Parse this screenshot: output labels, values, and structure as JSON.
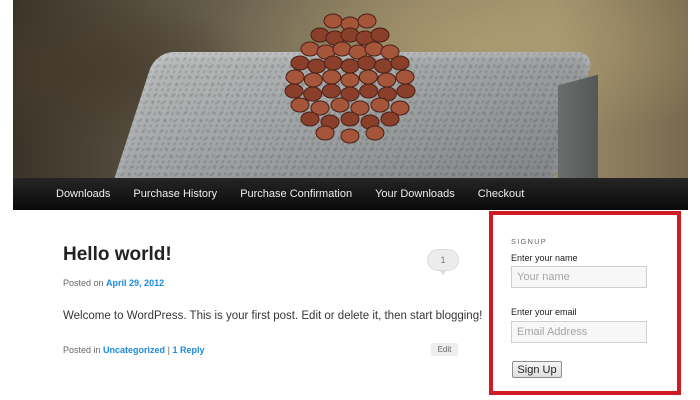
{
  "header": {
    "image_alt": "pinecone-on-granite"
  },
  "nav": {
    "items": [
      {
        "label": "Downloads"
      },
      {
        "label": "Purchase History"
      },
      {
        "label": "Purchase Confirmation"
      },
      {
        "label": "Your Downloads"
      },
      {
        "label": "Checkout"
      }
    ]
  },
  "post": {
    "title": "Hello world!",
    "posted_on_prefix": "Posted on",
    "date": "April 29, 2012",
    "comment_count": "1",
    "body": "Welcome to WordPress. This is your first post. Edit or delete it, then start blogging!",
    "posted_in_prefix": "Posted in",
    "category": "Uncategorized",
    "separator": "|",
    "reply_link": "1 Reply",
    "edit_label": "Edit"
  },
  "signup": {
    "title": "SIGNUP",
    "name_label": "Enter your name",
    "name_placeholder": "Your name",
    "email_label": "Enter your email",
    "email_placeholder": "Email Address",
    "button_label": "Sign Up"
  },
  "colors": {
    "link": "#1b8be0",
    "highlight_border": "#d11b22",
    "nav_background": "#111111"
  }
}
